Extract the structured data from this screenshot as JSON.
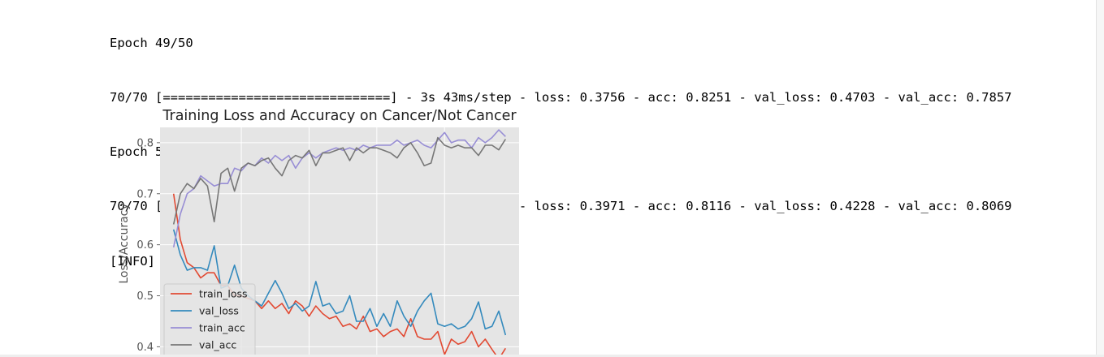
{
  "console": {
    "lines": [
      "Epoch 49/50",
      "70/70 [==============================] - 3s 43ms/step - loss: 0.3756 - acc: 0.8251 - val_loss: 0.4703 - val_acc: 0.7857",
      "Epoch 50/50",
      "70/70 [==============================] - 3s 44ms/step - loss: 0.3971 - acc: 0.8116 - val_loss: 0.4228 - val_acc: 0.8069",
      "[INFO] serializing network..."
    ]
  },
  "chart_data": {
    "type": "line",
    "title": "Training Loss and Accuracy on Cancer/Not Cancer",
    "xlabel": "",
    "ylabel": "Loss/Accuracy",
    "xlim": [
      -2,
      51
    ],
    "ylim": [
      0.38,
      0.83
    ],
    "yticks": [
      0.4,
      0.5,
      0.6,
      0.7,
      0.8
    ],
    "xgrid": [
      10,
      20,
      30,
      40
    ],
    "grid": true,
    "legend_position": "lower-left",
    "x": [
      0,
      1,
      2,
      3,
      4,
      5,
      6,
      7,
      8,
      9,
      10,
      11,
      12,
      13,
      14,
      15,
      16,
      17,
      18,
      19,
      20,
      21,
      22,
      23,
      24,
      25,
      26,
      27,
      28,
      29,
      30,
      31,
      32,
      33,
      34,
      35,
      36,
      37,
      38,
      39,
      40,
      41,
      42,
      43,
      44,
      45,
      46,
      47,
      48,
      49
    ],
    "series": [
      {
        "name": "train_loss",
        "color": "#e24a33",
        "values": [
          0.7,
          0.61,
          0.565,
          0.555,
          0.535,
          0.545,
          0.545,
          0.52,
          0.52,
          0.5,
          0.5,
          0.495,
          0.49,
          0.475,
          0.49,
          0.475,
          0.485,
          0.465,
          0.49,
          0.48,
          0.46,
          0.48,
          0.465,
          0.455,
          0.46,
          0.44,
          0.445,
          0.435,
          0.46,
          0.43,
          0.435,
          0.42,
          0.43,
          0.435,
          0.42,
          0.455,
          0.42,
          0.415,
          0.415,
          0.43,
          0.385,
          0.415,
          0.405,
          0.41,
          0.43,
          0.4,
          0.415,
          0.395,
          0.376,
          0.397
        ]
      },
      {
        "name": "val_loss",
        "color": "#348abd",
        "values": [
          0.63,
          0.58,
          0.55,
          0.555,
          0.555,
          0.55,
          0.598,
          0.515,
          0.52,
          0.56,
          0.515,
          0.5,
          0.49,
          0.48,
          0.505,
          0.53,
          0.505,
          0.475,
          0.485,
          0.47,
          0.48,
          0.528,
          0.48,
          0.485,
          0.465,
          0.47,
          0.5,
          0.45,
          0.45,
          0.475,
          0.44,
          0.465,
          0.44,
          0.49,
          0.46,
          0.44,
          0.47,
          0.49,
          0.505,
          0.445,
          0.44,
          0.445,
          0.435,
          0.44,
          0.455,
          0.488,
          0.435,
          0.44,
          0.47,
          0.423
        ]
      },
      {
        "name": "train_acc",
        "color": "#988ed5",
        "values": [
          0.595,
          0.66,
          0.7,
          0.71,
          0.735,
          0.725,
          0.715,
          0.72,
          0.72,
          0.75,
          0.745,
          0.76,
          0.755,
          0.77,
          0.76,
          0.775,
          0.765,
          0.775,
          0.75,
          0.77,
          0.78,
          0.77,
          0.78,
          0.785,
          0.79,
          0.785,
          0.79,
          0.785,
          0.795,
          0.79,
          0.795,
          0.795,
          0.795,
          0.805,
          0.795,
          0.8,
          0.805,
          0.795,
          0.79,
          0.805,
          0.82,
          0.8,
          0.805,
          0.805,
          0.79,
          0.81,
          0.8,
          0.81,
          0.825,
          0.812
        ]
      },
      {
        "name": "val_acc",
        "color": "#777777",
        "values": [
          0.64,
          0.7,
          0.72,
          0.71,
          0.73,
          0.715,
          0.645,
          0.74,
          0.75,
          0.705,
          0.75,
          0.76,
          0.755,
          0.765,
          0.77,
          0.75,
          0.735,
          0.765,
          0.775,
          0.77,
          0.785,
          0.755,
          0.78,
          0.78,
          0.785,
          0.79,
          0.765,
          0.79,
          0.78,
          0.79,
          0.79,
          0.785,
          0.78,
          0.77,
          0.79,
          0.8,
          0.78,
          0.755,
          0.76,
          0.81,
          0.795,
          0.79,
          0.795,
          0.79,
          0.79,
          0.775,
          0.795,
          0.795,
          0.786,
          0.807
        ]
      }
    ]
  }
}
